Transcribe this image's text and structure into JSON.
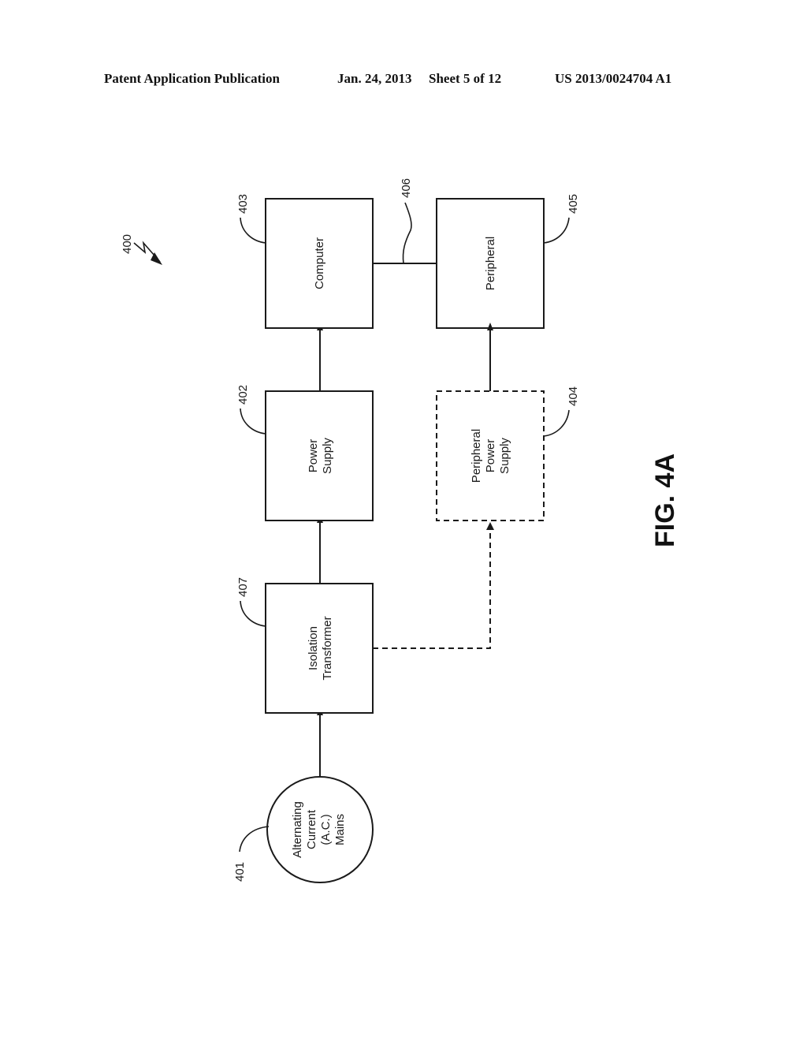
{
  "header": {
    "publication_type": "Patent Application Publication",
    "date": "Jan. 24, 2013",
    "sheet": "Sheet 5 of 12",
    "patent_number": "US 2013/0024704 A1"
  },
  "figure": {
    "label": "FIG. 4A",
    "system_ref": "400",
    "blocks": [
      {
        "id": "401",
        "ref": "401",
        "shape": "circle",
        "lines": [
          "Alternating",
          "Current",
          "(A.C.)",
          "Mains"
        ]
      },
      {
        "id": "407",
        "ref": "407",
        "shape": "rect",
        "lines": [
          "Isolation",
          "Transformer"
        ]
      },
      {
        "id": "402",
        "ref": "402",
        "shape": "rect",
        "lines": [
          "Power",
          "Supply"
        ]
      },
      {
        "id": "403",
        "ref": "403",
        "shape": "rect",
        "lines": [
          "Computer"
        ]
      },
      {
        "id": "404",
        "ref": "404",
        "shape": "rect-dashed",
        "lines": [
          "Peripheral",
          "Power",
          "Supply"
        ]
      },
      {
        "id": "405",
        "ref": "405",
        "shape": "rect",
        "lines": [
          "Peripheral"
        ]
      }
    ],
    "connections": [
      {
        "from": "401",
        "to": "407",
        "style": "solid-arrow"
      },
      {
        "from": "407",
        "to": "402",
        "style": "solid-arrow"
      },
      {
        "from": "402",
        "to": "403",
        "style": "solid-arrow"
      },
      {
        "from": "407",
        "to": "404",
        "style": "dashed-arrow"
      },
      {
        "from": "404",
        "to": "405",
        "style": "solid-arrow"
      },
      {
        "from": "403",
        "to": "405",
        "style": "solid-line",
        "ref": "406"
      }
    ]
  }
}
